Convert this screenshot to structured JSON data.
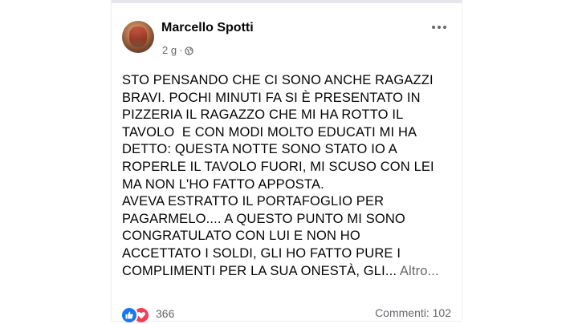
{
  "post": {
    "author": "Marcello Spotti",
    "time": "2 g",
    "separator": "·",
    "privacy_icon": "globe-icon",
    "more_icon": "more-options-icon",
    "text_lines": [
      "STO PENSANDO CHE CI SONO ANCHE RAGAZZI",
      "BRAVI. POCHI MINUTI FA SI È PRESENTATO IN",
      "PIZZERIA IL RAGAZZO CHE MI HA ROTTO IL",
      "TAVOLO  E CON MODI MOLTO EDUCATI MI HA",
      "DETTO: QUESTA NOTTE SONO STATO IO A",
      "ROPERLE IL TAVOLO FUORI, MI SCUSO CON LEI",
      "MA NON L'HO FATTO APPOSTA.",
      "AVEVA ESTRATTO IL PORTAFOGLIO PER",
      "PAGARMELO.... A QUESTO PUNTO MI SONO",
      "CONGRATULATO CON LUI E NON HO",
      "ACCETTATO I SOLDI, GLI HO FATTO PURE I"
    ],
    "last_line": "COMPLIMENTI PER LA SUA ONESTÀ, GLI...",
    "see_more": "Altro...",
    "reactions": {
      "count": "366",
      "icons": [
        "like-icon",
        "love-icon"
      ],
      "like_color": "#1877f2",
      "love_color": "#f33e58"
    },
    "comments_label": "Commenti: 102"
  }
}
